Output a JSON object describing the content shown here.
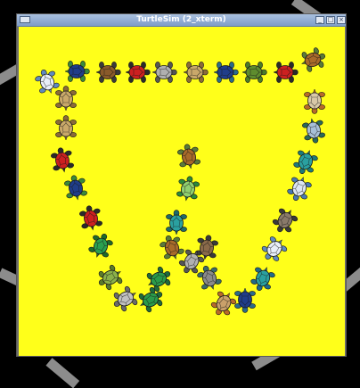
{
  "window": {
    "title": "TurtleSim (2_xterm)",
    "canvas_color": "#ffff1a",
    "buttons": [
      {
        "name": "minimize",
        "glyph": "_"
      },
      {
        "name": "maximize",
        "glyph": "□"
      },
      {
        "name": "close",
        "glyph": "×"
      }
    ]
  },
  "turtles": [
    {
      "shell": "#e8eef8",
      "skin": "#5f8ac0"
    },
    {
      "shell": "#1f3d8a",
      "skin": "#3a8a3a"
    },
    {
      "shell": "#8a5a2a",
      "skin": "#3a3a3a"
    },
    {
      "shell": "#cc2020",
      "skin": "#2a2a2a"
    },
    {
      "shell": "#b0b0b0",
      "skin": "#555555"
    },
    {
      "shell": "#c9a86a",
      "skin": "#8a6a3a"
    },
    {
      "shell": "#1f3d8a",
      "skin": "#2a6a8a"
    },
    {
      "shell": "#5e8c2e",
      "skin": "#4a7a2a"
    },
    {
      "shell": "#cc2020",
      "skin": "#2a2a2a"
    },
    {
      "shell": "#a86a2a",
      "skin": "#5a7a3a"
    },
    {
      "shell": "#d8c8a8",
      "skin": "#b86a2a"
    },
    {
      "shell": "#a8c0d8",
      "skin": "#2a6a5a"
    },
    {
      "shell": "#2aa0a0",
      "skin": "#1f7a7a"
    },
    {
      "shell": "#dce6f2",
      "skin": "#4a7ab0"
    },
    {
      "shell": "#8a7a6a",
      "skin": "#3a3a3a"
    },
    {
      "shell": "#e8eef8",
      "skin": "#5f8ac0"
    },
    {
      "shell": "#2aa0a0",
      "skin": "#1f6a8a"
    },
    {
      "shell": "#1f3d8a",
      "skin": "#2a6a8a"
    },
    {
      "shell": "#c9a06a",
      "skin": "#b86a2a"
    },
    {
      "shell": "#8a8a8a",
      "skin": "#3a6a6a"
    },
    {
      "shell": "#8a6a4a",
      "skin": "#3a3a3a"
    },
    {
      "shell": "#b0b0b0",
      "skin": "#555555"
    },
    {
      "shell": "#2aa0a0",
      "skin": "#1f6a6a"
    },
    {
      "shell": "#90d070",
      "skin": "#2a8a3a"
    },
    {
      "shell": "#a86a2a",
      "skin": "#5a7a3a"
    },
    {
      "shell": "#2a9a4a",
      "skin": "#1f6a3a"
    },
    {
      "shell": "#a86a2a",
      "skin": "#5a7a3a"
    },
    {
      "shell": "#c0c0c0",
      "skin": "#6a6a6a"
    },
    {
      "shell": "#2a9a4a",
      "skin": "#1f6a3a"
    },
    {
      "shell": "#8ab04a",
      "skin": "#5a7a2a"
    },
    {
      "shell": "#2aa050",
      "skin": "#1f6a2a"
    },
    {
      "shell": "#cc2020",
      "skin": "#2a2a2a"
    },
    {
      "shell": "#1f3d8a",
      "skin": "#3a8a3a"
    },
    {
      "shell": "#cc2020",
      "skin": "#2a2a2a"
    },
    {
      "shell": "#c9a86a",
      "skin": "#8a6a3a"
    },
    {
      "shell": "#c9a86a",
      "skin": "#8a6a3a"
    }
  ]
}
